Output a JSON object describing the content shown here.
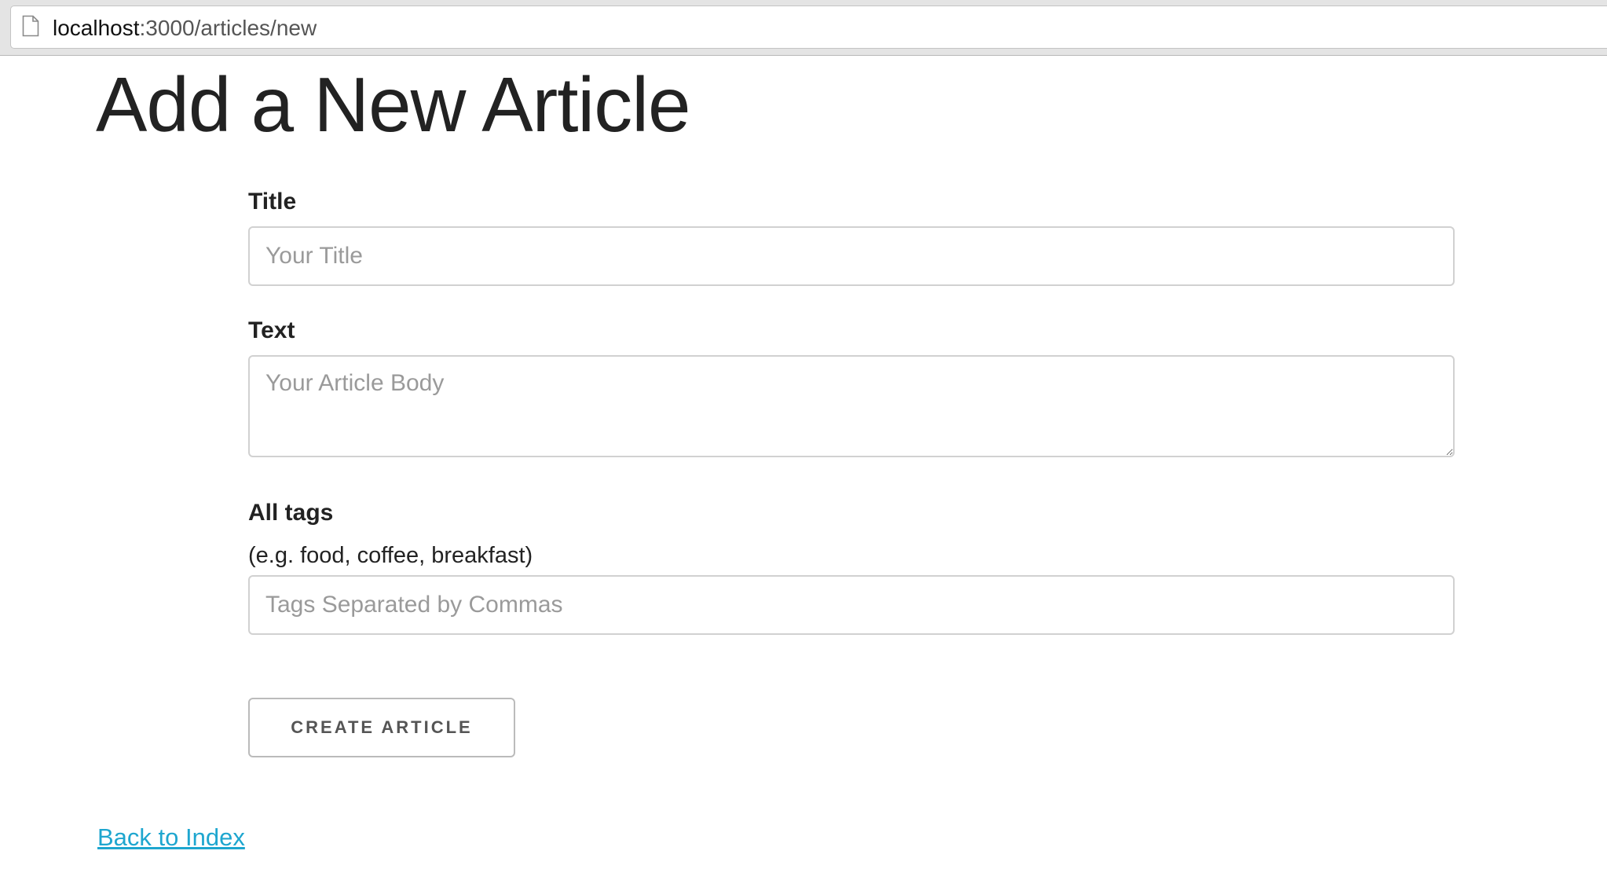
{
  "browser": {
    "url_host": "localhost",
    "url_path": ":3000/articles/new",
    "page_icon": "document-icon"
  },
  "page": {
    "title": "Add a New Article"
  },
  "form": {
    "title_label": "Title",
    "title_placeholder": "Your Title",
    "title_value": "",
    "text_label": "Text",
    "text_placeholder": "Your Article Body",
    "text_value": "",
    "tags_label": "All tags",
    "tags_hint": "(e.g. food, coffee, breakfast)",
    "tags_placeholder": "Tags Separated by Commas",
    "tags_value": "",
    "submit_label": "Create Article"
  },
  "footer": {
    "back_link": "Back to Index"
  },
  "colors": {
    "link": "#1ea6cf",
    "text": "#222222",
    "placeholder": "#9a9a9a",
    "border": "#d1d1d1"
  }
}
